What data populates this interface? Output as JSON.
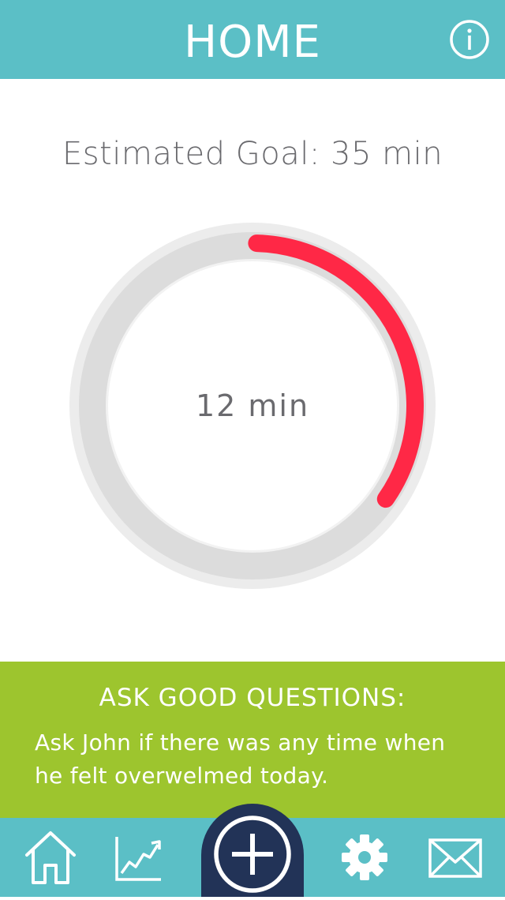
{
  "header": {
    "title": "HOME",
    "info_icon": "info-icon"
  },
  "goal": {
    "label": "Estimated Goal:",
    "value": "35 min"
  },
  "progress": {
    "current_minutes": 12,
    "goal_minutes": 35,
    "fraction": 0.343,
    "center_label": "12 min"
  },
  "tip": {
    "title": "ASK GOOD QUESTIONS:",
    "body": "Ask John if there was any time when he felt overwelmed today."
  },
  "tabbar": {
    "items": [
      {
        "icon": "home-icon"
      },
      {
        "icon": "chart-icon"
      },
      {
        "icon": "add-icon"
      },
      {
        "icon": "gear-icon"
      },
      {
        "icon": "mail-icon"
      }
    ]
  },
  "colors": {
    "header": "#5bbfc6",
    "progress": "#ff2846",
    "tip": "#9dc52e",
    "add_button": "#223357",
    "text": "#6a6a6e"
  }
}
